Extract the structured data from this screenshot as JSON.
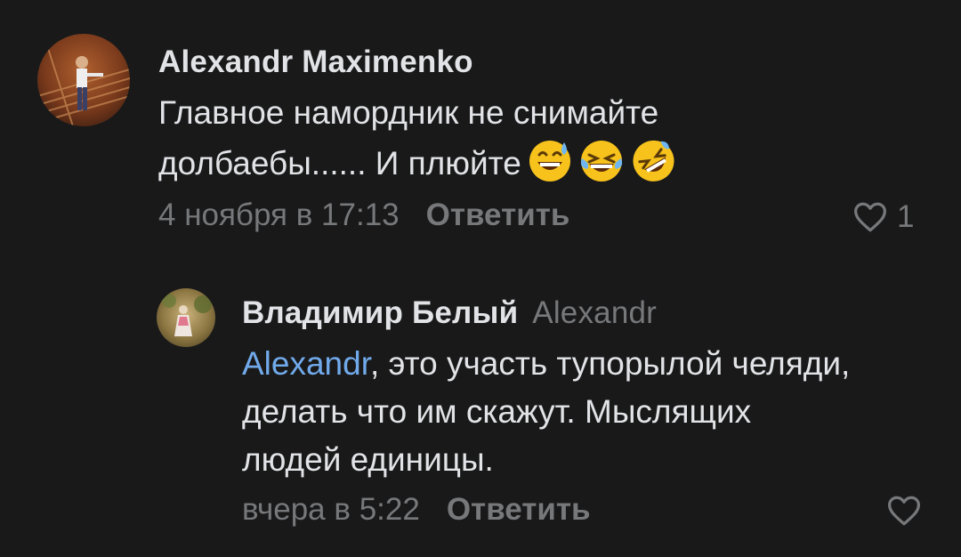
{
  "comments": [
    {
      "author": "Alexandr Maximenko",
      "text_line1": "Главное намордник не снимайте",
      "text_line2": "долбаебы...... И плюйте",
      "emojis": [
        "grinning-sweat",
        "tears-of-joy",
        "rolling-on-floor-laughing"
      ],
      "date": "4 ноября в 17:13",
      "reply_label": "Ответить",
      "like_count": "1"
    },
    {
      "author": "Владимир Белый",
      "reply_to": "Alexandr",
      "mention": "Alexandr",
      "text_line1_rest": ", это участь тупорылой челяди,",
      "text_line2": "делать что им скажут. Мыслящих",
      "text_line3": "людей единицы.",
      "date": "вчера в 5:22",
      "reply_label": "Ответить"
    }
  ],
  "colors": {
    "background": "#19191a",
    "text": "#e1e3e6",
    "secondary": "#76787a",
    "link": "#71aaeb"
  }
}
